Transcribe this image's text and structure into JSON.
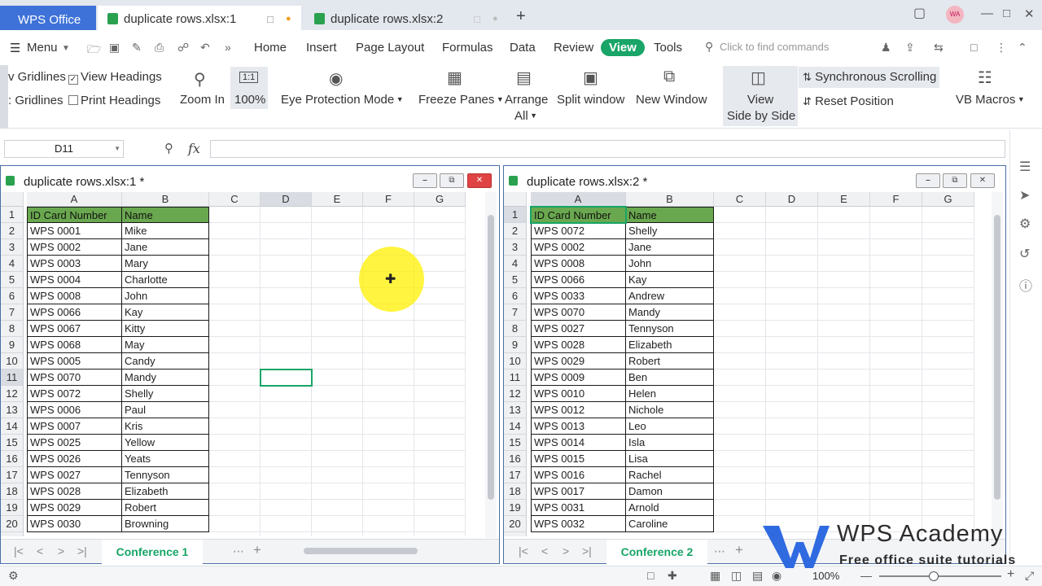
{
  "titlebar": {
    "app_tab": "WPS Office",
    "tabs": [
      {
        "label": "duplicate rows.xlsx:1",
        "active": true
      },
      {
        "label": "duplicate rows.xlsx:2",
        "active": false
      }
    ],
    "new_tab": "+",
    "avatar": "WA"
  },
  "menubar": {
    "menu_label": "Menu",
    "items": [
      "Home",
      "Insert",
      "Page Layout",
      "Formulas",
      "Data",
      "Review",
      "View",
      "Tools"
    ],
    "active": "View",
    "search_placeholder": "Click to find commands"
  },
  "ribbon": {
    "gridlines_top": "v Gridlines",
    "view_headings": "View Headings",
    "gridlines_bottom": ": Gridlines",
    "print_headings": "Print Headings",
    "zoom_in": "Zoom In",
    "zoom_100_icon": "1:1",
    "zoom_100": "100%",
    "eye_protection": "Eye Protection Mode",
    "freeze_panes": "Freeze Panes",
    "arrange_line1": "Arrange",
    "arrange_line2": "All",
    "split_window": "Split window",
    "new_window": "New Window",
    "view_sbs_line1": "View",
    "view_sbs_line2": "Side by Side",
    "sync_scrolling": "Synchronous Scrolling",
    "reset_position": "Reset Position",
    "vb_macros": "VB Macros"
  },
  "formulabar": {
    "cell_ref": "D11",
    "fx": "fx"
  },
  "columns": [
    "A",
    "B",
    "C",
    "D",
    "E",
    "F",
    "G"
  ],
  "window1": {
    "title": "duplicate rows.xlsx:1 *",
    "sheet_tab": "Conference 1",
    "headers": [
      "ID Card Number",
      "Name"
    ],
    "rows": [
      [
        "WPS 0001",
        "Mike"
      ],
      [
        "WPS 0002",
        "Jane"
      ],
      [
        "WPS 0003",
        "Mary"
      ],
      [
        "WPS 0004",
        "Charlotte"
      ],
      [
        "WPS 0008",
        "John"
      ],
      [
        "WPS 0066",
        "Kay"
      ],
      [
        "WPS 0067",
        "Kitty"
      ],
      [
        "WPS 0068",
        "May"
      ],
      [
        "WPS 0005",
        "Candy"
      ],
      [
        "WPS 0070",
        "Mandy"
      ],
      [
        "WPS 0072",
        "Shelly"
      ],
      [
        "WPS 0006",
        "Paul"
      ],
      [
        "WPS 0007",
        "Kris"
      ],
      [
        "WPS 0025",
        "Yellow"
      ],
      [
        "WPS 0026",
        "Yeats"
      ],
      [
        "WPS 0027",
        "Tennyson"
      ],
      [
        "WPS 0028",
        "Elizabeth"
      ],
      [
        "WPS 0029",
        "Robert"
      ],
      [
        "WPS 0030",
        "Browning"
      ]
    ]
  },
  "window2": {
    "title": "duplicate rows.xlsx:2 *",
    "sheet_tab": "Conference 2",
    "headers": [
      "ID Card Number",
      "Name"
    ],
    "rows": [
      [
        "WPS 0072",
        "Shelly"
      ],
      [
        "WPS 0002",
        "Jane"
      ],
      [
        "WPS 0008",
        "John"
      ],
      [
        "WPS 0066",
        "Kay"
      ],
      [
        "WPS 0033",
        "Andrew"
      ],
      [
        "WPS 0070",
        "Mandy"
      ],
      [
        "WPS 0027",
        "Tennyson"
      ],
      [
        "WPS 0028",
        "Elizabeth"
      ],
      [
        "WPS 0029",
        "Robert"
      ],
      [
        "WPS 0009",
        "Ben"
      ],
      [
        "WPS 0010",
        "Helen"
      ],
      [
        "WPS 0012",
        "Nichole"
      ],
      [
        "WPS 0013",
        "Leo"
      ],
      [
        "WPS 0014",
        "Isla"
      ],
      [
        "WPS 0015",
        "Lisa"
      ],
      [
        "WPS 0016",
        "Rachel"
      ],
      [
        "WPS 0017",
        "Damon"
      ],
      [
        "WPS 0031",
        "Arnold"
      ],
      [
        "WPS 0032",
        "Caroline"
      ]
    ]
  },
  "statusbar": {
    "zoom": "100%"
  },
  "watermark": {
    "title": "WPS Academy",
    "subtitle": "Free office suite tutorials"
  },
  "colors": {
    "accent": "#18a567",
    "header_fill": "#6aa84f",
    "wps_blue": "#3e72d8"
  }
}
